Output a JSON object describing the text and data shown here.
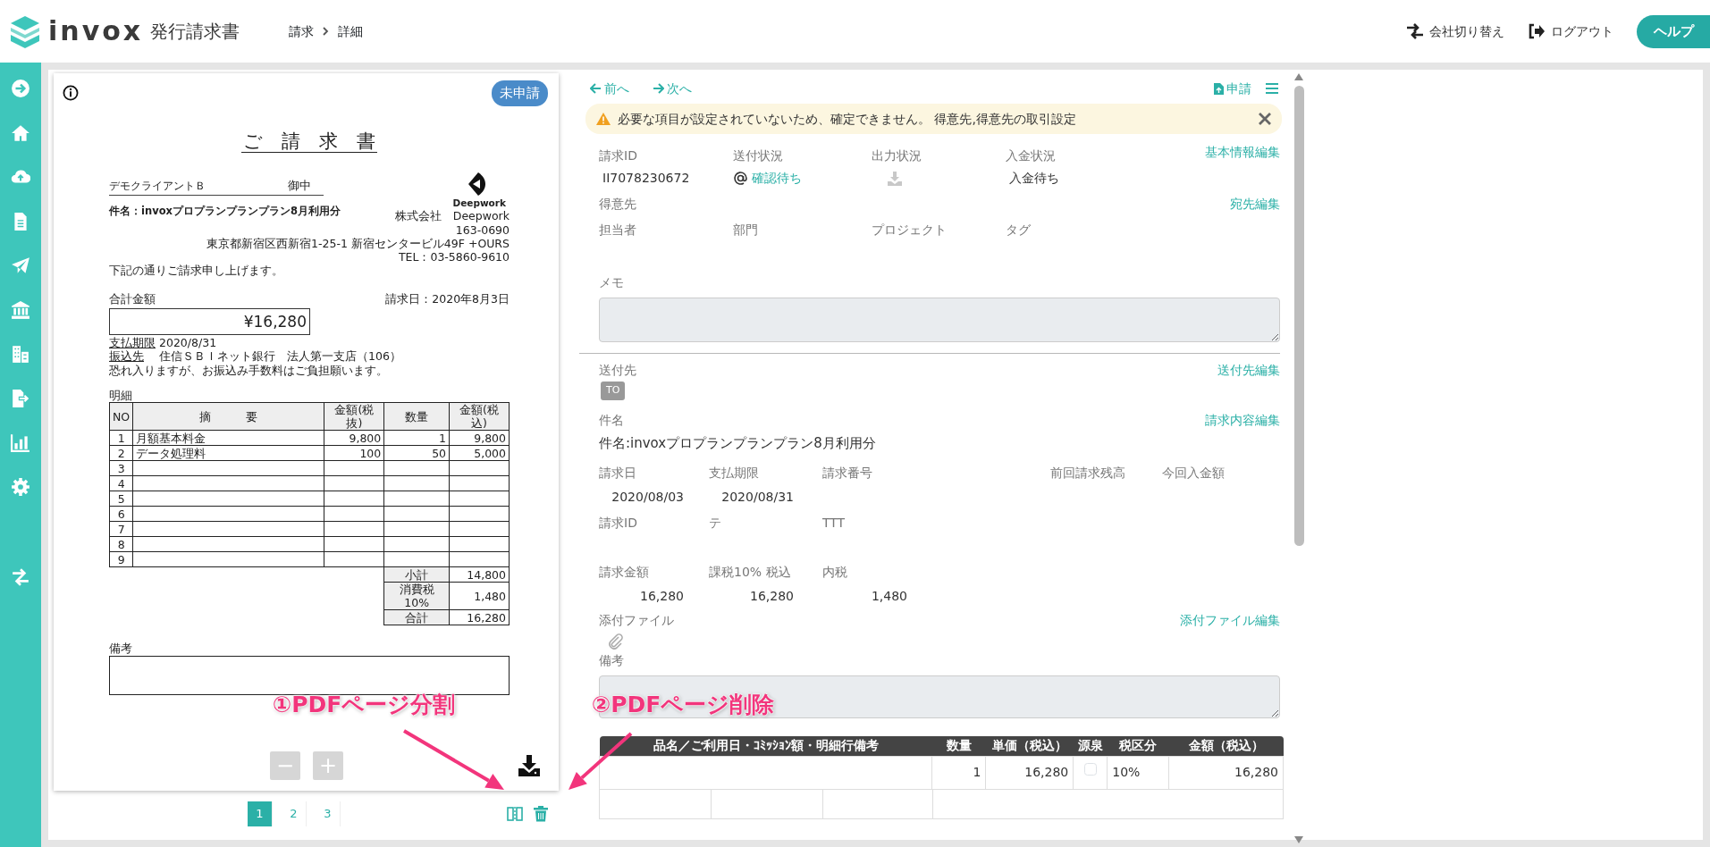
{
  "header": {
    "logo": "invox",
    "product": "発行請求書",
    "breadcrumb": [
      "請求",
      "詳細"
    ],
    "actions": [
      {
        "label": "会社切り替え",
        "kind": "switch"
      },
      {
        "label": "ログアウト",
        "kind": "logout"
      }
    ],
    "help": "ヘルプ"
  },
  "sidebar": {
    "items": [
      {
        "kind": "arrow"
      },
      {
        "kind": "home"
      },
      {
        "kind": "upload"
      },
      {
        "kind": "document"
      },
      {
        "kind": "send"
      },
      {
        "kind": "bank"
      },
      {
        "kind": "building"
      },
      {
        "kind": "export"
      },
      {
        "kind": "chart"
      },
      {
        "kind": "settings"
      },
      {
        "kind": "switch"
      }
    ]
  },
  "document": {
    "status": "未申請",
    "title": "ご　請　求　書",
    "client": "デモクライアントＢ",
    "honorific": "御中",
    "subject": "件名：invoxプロプランプランプラン8月利用分",
    "company": {
      "logo": "Deepwork",
      "name": "株式会社　Deepwork",
      "postal": "163-0690",
      "address": "東京都新宿区西新宿1-25-1 新宿センタービル49F +OURS",
      "tel": "TEL：03-5860-9610"
    },
    "greeting": "下記の通りご請求申し上げます。",
    "total_label": "合計金額",
    "date": "請求日：2020年8月3日",
    "total": "¥16,280",
    "due_label": "支払期限",
    "due": "2020/8/31",
    "bank_label": "振込先",
    "bank": "住信ＳＢＩネット銀行　法人第一支店（106）",
    "note": "恐れ入りますが、お振込み手数料はご負担願います。",
    "detail_label": "明細",
    "columns": [
      "NO",
      "摘　　　要",
      "金額(税抜)",
      "数量",
      "金額(税込)"
    ],
    "rows": [
      {
        "no": "1",
        "desc": "月額基本料金",
        "price": "9,800",
        "qty": "1",
        "amount": "9,800"
      },
      {
        "no": "2",
        "desc": "データ処理料",
        "price": "100",
        "qty": "50",
        "amount": "5,000"
      },
      {
        "no": "3"
      },
      {
        "no": "4"
      },
      {
        "no": "5"
      },
      {
        "no": "6"
      },
      {
        "no": "7"
      },
      {
        "no": "8"
      },
      {
        "no": "9"
      }
    ],
    "summary": [
      {
        "label": "小計",
        "value": "14,800"
      },
      {
        "label": "消費税10%",
        "value": "1,480"
      },
      {
        "label": "合計",
        "value": "16,280"
      }
    ],
    "remarks_label": "備考"
  },
  "zoom_buttons": [
    {
      "label": "−",
      "disabled": true
    },
    {
      "label": "+",
      "disabled": true
    }
  ],
  "pager": {
    "pages": [
      {
        "label": "1",
        "selected": true
      },
      {
        "label": "2",
        "selected": false
      },
      {
        "label": "3",
        "selected": false
      }
    ]
  },
  "detail": {
    "nav": {
      "prev": "前へ",
      "next": "次へ",
      "apply": "申請"
    },
    "alert": "必要な項目が設定されていないため、確定できません。 得意先,得意先の取引設定",
    "status": {
      "edit": "基本情報編集",
      "fields": [
        {
          "label": "請求ID",
          "value": "II7078230672",
          "kind": "text"
        },
        {
          "label": "送付状況",
          "value": "確認待ち",
          "kind": "mail"
        },
        {
          "label": "出力状況",
          "kind": "download"
        },
        {
          "label": "入金状況",
          "value": "入金待ち",
          "kind": "text"
        }
      ]
    },
    "customer": {
      "label": "得意先",
      "edit": "宛先編集",
      "fields": [
        "担当者",
        "部門",
        "プロジェクト",
        "タグ"
      ]
    },
    "memo": {
      "label": "メモ"
    },
    "recipient": {
      "label": "送付先",
      "edit": "送付先編集",
      "tags": [
        "TO"
      ]
    },
    "subject": {
      "label": "件名",
      "edit": "請求内容編集",
      "value": "件名:invoxプロプランプランプラン8月利用分"
    },
    "dates": [
      {
        "label": "請求日",
        "value": "2020/08/03"
      },
      {
        "label": "支払期限",
        "value": "2020/08/31"
      },
      {
        "label": "請求番号"
      },
      {
        "label": "前回請求残高"
      },
      {
        "label": "今回入金額"
      }
    ],
    "ids": [
      {
        "label": "請求ID"
      },
      {
        "label": "テ"
      },
      {
        "label": "TTT"
      }
    ],
    "amounts": [
      {
        "label": "請求金額",
        "value": "16,280"
      },
      {
        "label": "課税10% 税込",
        "value": "16,280"
      },
      {
        "label": "内税",
        "value": "1,480"
      }
    ],
    "attachments": {
      "label": "添付ファイル",
      "edit": "添付ファイル編集"
    },
    "remarks": {
      "label": "備考"
    },
    "lines": {
      "columns": [
        "品名／ご利用日・ｺﾐｯｼｮﾝ額・明細行備考",
        "数量",
        "単価（税込）",
        "源泉",
        "税区分",
        "金額（税込）"
      ],
      "rows": [
        {
          "qty": "1",
          "price": "16,280",
          "withholding": false,
          "tax": "10%",
          "amount": "16,280"
        }
      ]
    }
  },
  "annotations": [
    {
      "text": "①PDFページ分割"
    },
    {
      "text": "②PDFページ削除"
    }
  ]
}
